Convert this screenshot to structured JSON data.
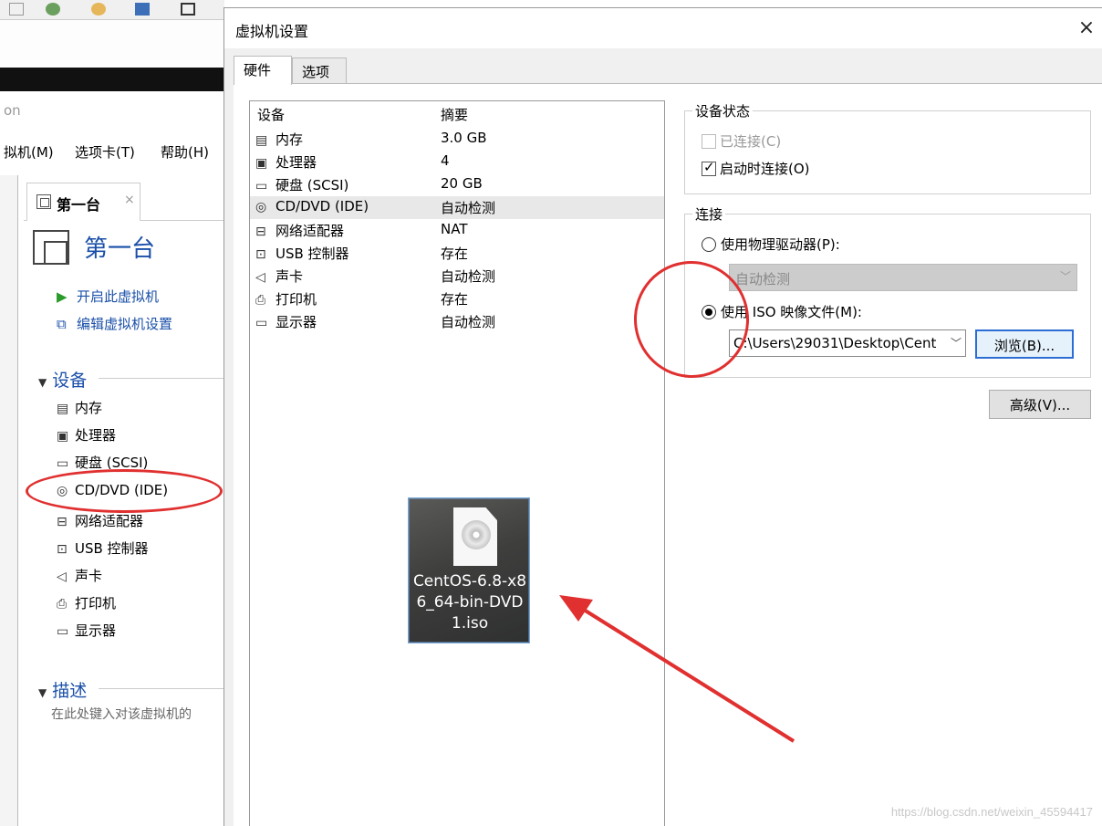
{
  "background_app": {
    "title_fragment": "on",
    "menu": [
      {
        "label": "拟机(M)"
      },
      {
        "label": "选项卡(T)"
      },
      {
        "label": "帮助(H)"
      }
    ],
    "tab": {
      "label": "第一台",
      "close": "×"
    },
    "vm_name": "第一台",
    "actions": [
      {
        "label": "开启此虚拟机",
        "icon": "play-icon"
      },
      {
        "label": "编辑虚拟机设置",
        "icon": "edit-settings-icon"
      }
    ],
    "devices_section": "设备",
    "devices": [
      {
        "label": "内存",
        "icon": "memory-icon"
      },
      {
        "label": "处理器",
        "icon": "cpu-icon"
      },
      {
        "label": "硬盘 (SCSI)",
        "icon": "harddisk-icon"
      },
      {
        "label": "CD/DVD (IDE)",
        "icon": "cd-dvd-icon"
      },
      {
        "label": "网络适配器",
        "icon": "network-icon"
      },
      {
        "label": "USB 控制器",
        "icon": "usb-icon"
      },
      {
        "label": "声卡",
        "icon": "sound-icon"
      },
      {
        "label": "打印机",
        "icon": "printer-icon"
      },
      {
        "label": "显示器",
        "icon": "display-icon"
      }
    ],
    "description_section": "描述",
    "description_hint": "在此处键入对该虚拟机的"
  },
  "dialog": {
    "title": "虚拟机设置",
    "close": "×",
    "tabs": [
      {
        "label": "硬件"
      },
      {
        "label": "选项"
      }
    ],
    "device_list": {
      "headers": {
        "device": "设备",
        "summary": "摘要"
      },
      "rows": [
        {
          "name": "内存",
          "summary": "3.0 GB",
          "icon": "memory-icon"
        },
        {
          "name": "处理器",
          "summary": "4",
          "icon": "cpu-icon"
        },
        {
          "name": "硬盘 (SCSI)",
          "summary": "20 GB",
          "icon": "harddisk-icon"
        },
        {
          "name": "CD/DVD (IDE)",
          "summary": "自动检测",
          "icon": "cd-dvd-icon",
          "selected": true
        },
        {
          "name": "网络适配器",
          "summary": "NAT",
          "icon": "network-icon"
        },
        {
          "name": "USB 控制器",
          "summary": "存在",
          "icon": "usb-icon"
        },
        {
          "name": "声卡",
          "summary": "自动检测",
          "icon": "sound-icon"
        },
        {
          "name": "打印机",
          "summary": "存在",
          "icon": "printer-icon"
        },
        {
          "name": "显示器",
          "summary": "自动检测",
          "icon": "display-icon"
        }
      ]
    },
    "device_status": {
      "legend": "设备状态",
      "connected": {
        "label": "已连接(C)",
        "checked": false,
        "disabled": true
      },
      "connect_at_power_on": {
        "label": "启动时连接(O)",
        "checked": true
      }
    },
    "connection": {
      "legend": "连接",
      "physical_drive": {
        "label": "使用物理驱动器(P):",
        "selected": false
      },
      "physical_drive_value": "自动检测",
      "iso_image": {
        "label": "使用 ISO 映像文件(M):",
        "selected": true
      },
      "iso_path": "C:\\Users\\29031\\Desktop\\Cent",
      "browse_label": "浏览(B)..."
    },
    "advanced_label": "高级(V)..."
  },
  "desktop_file": {
    "name": "CentOS-6.8-x86_64-bin-DVD1.iso",
    "icon": "disc-image-file-icon"
  },
  "watermark": "https://blog.csdn.net/weixin_45594417",
  "colors": {
    "link_blue": "#1a4fa8",
    "annotation_red": "#e03030",
    "selection_gray": "#e8e8e8",
    "focus_blue": "#2c6ed5"
  }
}
